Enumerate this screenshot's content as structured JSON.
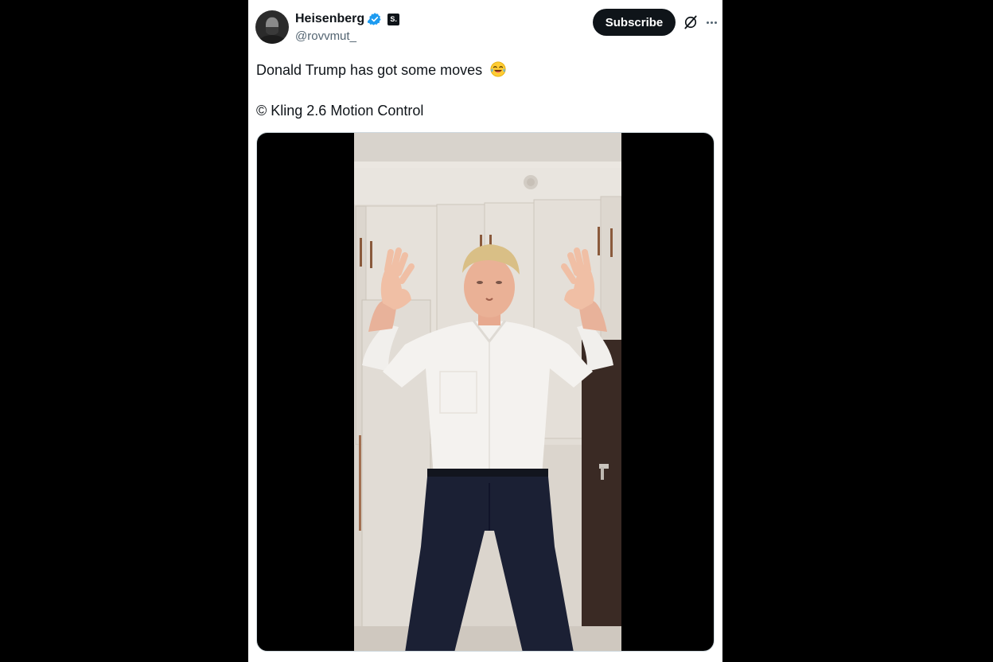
{
  "tweet": {
    "author": {
      "display_name": "Heisenberg",
      "handle": "@rovvmut_",
      "verified": true,
      "subscriber_badge": "S."
    },
    "actions": {
      "subscribe_label": "Subscribe",
      "grok_icon": "grok-icon",
      "more_icon": "more-options-icon"
    },
    "text_line_1": "Donald Trump has got some moves",
    "text_line_1_emoji": "face-with-tears-of-joy-icon",
    "text_line_2": "© Kling 2.6 Motion Control",
    "media": {
      "type": "video",
      "subject": "man in white shirt and navy trousers with raised hands in a room with white wardrobes"
    }
  },
  "colors": {
    "background": "#000000",
    "card": "#ffffff",
    "primary_text": "#0f1419",
    "secondary_text": "#536471",
    "verified_blue": "#1d9bf0",
    "button_bg": "#0f1419"
  }
}
